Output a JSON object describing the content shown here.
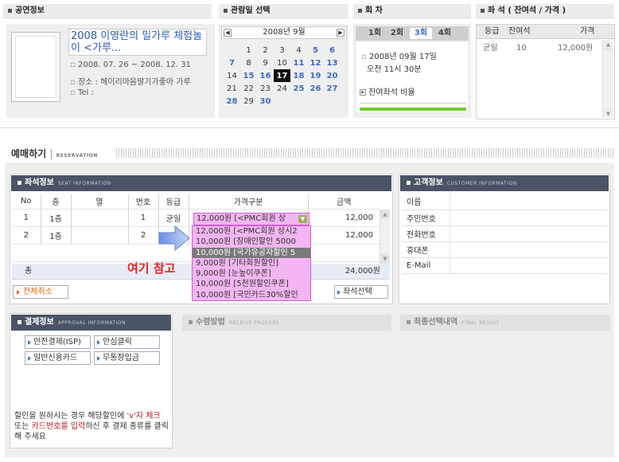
{
  "sections": {
    "performance": "공연정보",
    "date_select": "관람일 선택",
    "round": "회 차",
    "seats": "좌 석 ( 잔여석 / 가격 )"
  },
  "performance": {
    "title": "2008 이영란의 밀가루 체험놀이 <가루...",
    "period": "2008. 07. 26 ~ 2008. 12. 31",
    "venue": "장소 : 헤이리마음딸기가좋아 가루",
    "tel": "Tel :"
  },
  "calendar": {
    "month": "2008년 9월",
    "weeks": [
      [
        "",
        "1",
        "2",
        "3",
        "4",
        "5",
        "6"
      ],
      [
        "7",
        "8",
        "9",
        "10",
        "11",
        "12",
        "13"
      ],
      [
        "14",
        "15",
        "16",
        "17",
        "18",
        "19",
        "20"
      ],
      [
        "21",
        "22",
        "23",
        "24",
        "25",
        "26",
        "27"
      ],
      [
        "28",
        "29",
        "30",
        "",
        "",
        "",
        ""
      ]
    ],
    "selected": "17"
  },
  "rounds": {
    "tabs": [
      "1회",
      "2회",
      "3회",
      "4회"
    ],
    "active": "3회",
    "date": "2008년 09월 17일",
    "time": "오전 11시 30분",
    "remaining_ratio": "잔여좌석 비율"
  },
  "seat_list": {
    "headers": [
      "등급",
      "잔여석",
      "가격"
    ],
    "rows": [
      [
        "균일",
        "10",
        "12,000원"
      ]
    ]
  },
  "reservation": {
    "title": "예매하기",
    "title_eng": "RESERVATION"
  },
  "seat_info": {
    "title": "좌석정보",
    "title_eng": "SEAT INFORMATION",
    "headers": [
      "No",
      "층",
      "열",
      "번호",
      "등급",
      "가격구분",
      "금액"
    ],
    "rows": [
      {
        "no": "1",
        "floor": "1층",
        "row": "",
        "num": "1",
        "grade": "균일",
        "price_type": "12,000원 [<PMC회원 상",
        "amount": "12,000"
      },
      {
        "no": "2",
        "floor": "1층",
        "row": "",
        "num": "2",
        "grade": "균일",
        "price_type": "",
        "amount": "12,000"
      }
    ],
    "total_label": "총",
    "total_amount": "24,000원",
    "cancel_all": "전체취소",
    "select_seat": "좌석선택"
  },
  "dropdown_options": [
    "12,000원  [<PMC회원 상시2",
    "10,000원  [장애인할인 5000",
    "10,000원  [국가유공자할인 5",
    "9,000원  [기타회원할인]",
    "9,000원  [눈높이쿠폰]",
    "10,000원  [5천원할인쿠폰]",
    "10,000원  [국민카드30%할인"
  ],
  "annotation": "여기 참고",
  "customer": {
    "title": "고객정보",
    "title_eng": "CUSTOMER INFORMATION",
    "fields": [
      "이름",
      "주민번호",
      "전화번호",
      "휴대폰",
      "E-Mail"
    ]
  },
  "payment": {
    "title": "결제정보",
    "title_eng": "APPROVAL INFORMATION",
    "methods": [
      "안전결제(ISP)",
      "안심클릭",
      "일반신용카드",
      "무통장입금"
    ],
    "note_before": "할인을 원하시는 경우 해당할인에 ",
    "note_v": "'v'자 체크",
    "note_mid": " 또는 ",
    "note_card": "카드번호를 입력",
    "note_after": "하신 후 결제 종류를 클릭해 주세요"
  },
  "receive": {
    "title": "수령방법",
    "title_eng": "RECEIVE PROCESS"
  },
  "final": {
    "title": "최종선택내역",
    "title_eng": "FINAL RESULT"
  },
  "colors": {
    "header_dark": "#4a5466",
    "calendar_blue": "#3a6cc9",
    "dropdown_pink": "#f3b6f2",
    "dropdown_border": "#d060d0",
    "annotation_red": "#e82020",
    "progress_green": "#6fce2f"
  }
}
